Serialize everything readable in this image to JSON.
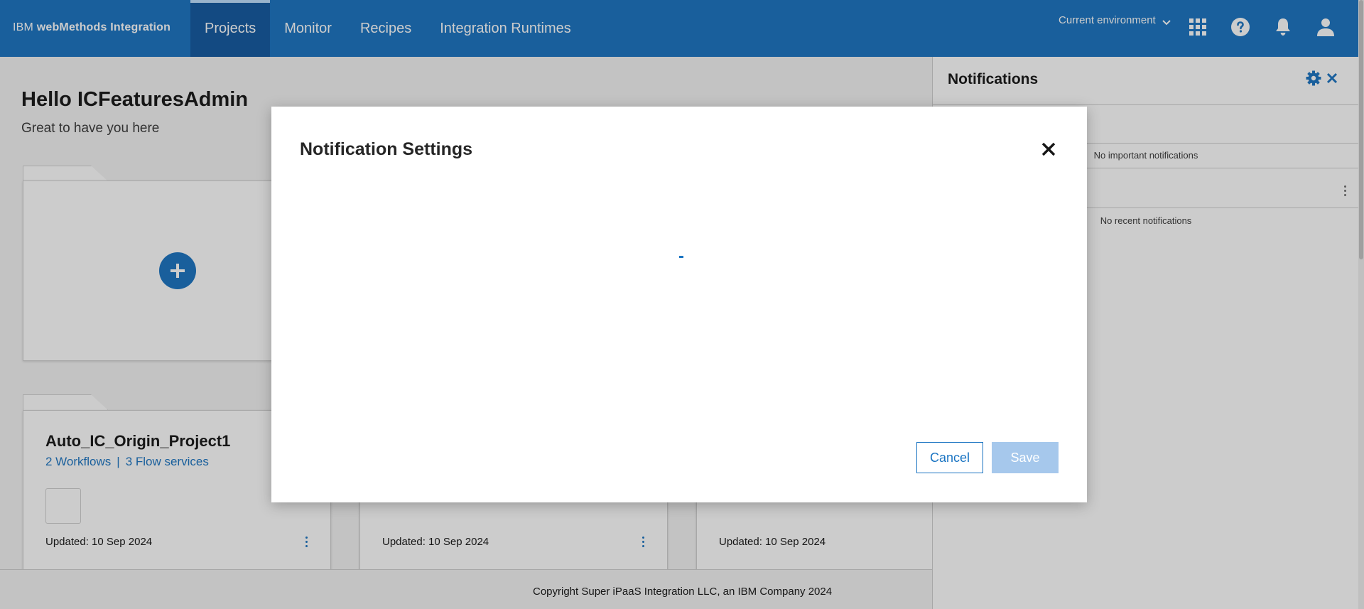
{
  "topbar": {
    "brand_prefix": "IBM",
    "brand_product": "webMethods Integration",
    "nav": [
      {
        "label": "Projects",
        "active": true
      },
      {
        "label": "Monitor",
        "active": false
      },
      {
        "label": "Recipes",
        "active": false
      },
      {
        "label": "Integration Runtimes",
        "active": false
      }
    ],
    "environment_label": "Current environment",
    "icons": [
      "app-switcher-icon",
      "help-icon",
      "bell-icon",
      "user-icon"
    ]
  },
  "main": {
    "greeting": "Hello ICFeaturesAdmin",
    "subgreeting": "Great to have you here",
    "projects": [
      {
        "name": "Auto_IC_Origin_Project1",
        "workflows": "2 Workflows",
        "separator": "|",
        "flow_services": "3 Flow services",
        "updated": "Updated: 10 Sep 2024"
      },
      {
        "updated": "Updated: 10 Sep 2024"
      },
      {
        "updated": "Updated: 10 Sep 2024"
      }
    ]
  },
  "footer": {
    "copyright": "Copyright Super iPaaS Integration LLC, an IBM Company 2024"
  },
  "notifications": {
    "title": "Notifications",
    "important_empty": "No important notifications",
    "recent_empty": "No recent notifications"
  },
  "modal": {
    "title": "Notification Settings",
    "cancel_label": "Cancel",
    "save_label": "Save",
    "save_enabled": false
  },
  "colors": {
    "primary": "#1a74c2",
    "topbar_active": "#1259a0",
    "save_disabled": "#a6c8ec"
  }
}
